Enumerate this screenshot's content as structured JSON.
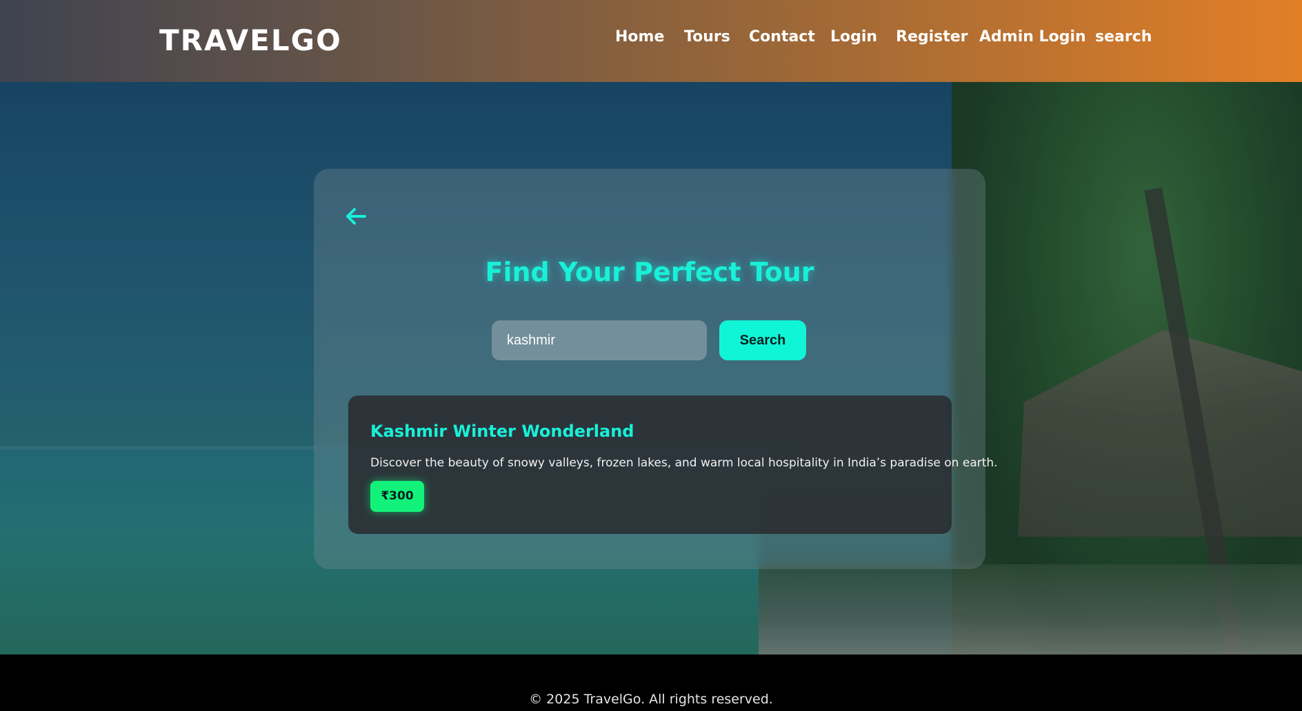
{
  "header": {
    "logo": "TRAVELGO",
    "nav": [
      {
        "label": "Home"
      },
      {
        "label": "Tours"
      },
      {
        "label": "Contact"
      },
      {
        "label": "Login"
      },
      {
        "label": "Register"
      },
      {
        "label": "Admin Login"
      },
      {
        "label": "search"
      }
    ]
  },
  "search_card": {
    "back_icon": "arrow-left-icon",
    "title": "Find Your Perfect Tour",
    "search_value": "kashmir",
    "search_button": "Search"
  },
  "results": [
    {
      "title": "Kashmir Winter Wonderland",
      "description": "Discover the beauty of snowy valleys, frozen lakes, and warm local hospitality in India’s paradise on earth.",
      "price": "₹300"
    }
  ],
  "footer": {
    "text": "© 2025 TravelGo. All rights reserved."
  },
  "colors": {
    "accent": "#19f0d8",
    "price_badge": "#12f27a",
    "header_start": "#3f4350",
    "header_end": "#e27f27"
  }
}
